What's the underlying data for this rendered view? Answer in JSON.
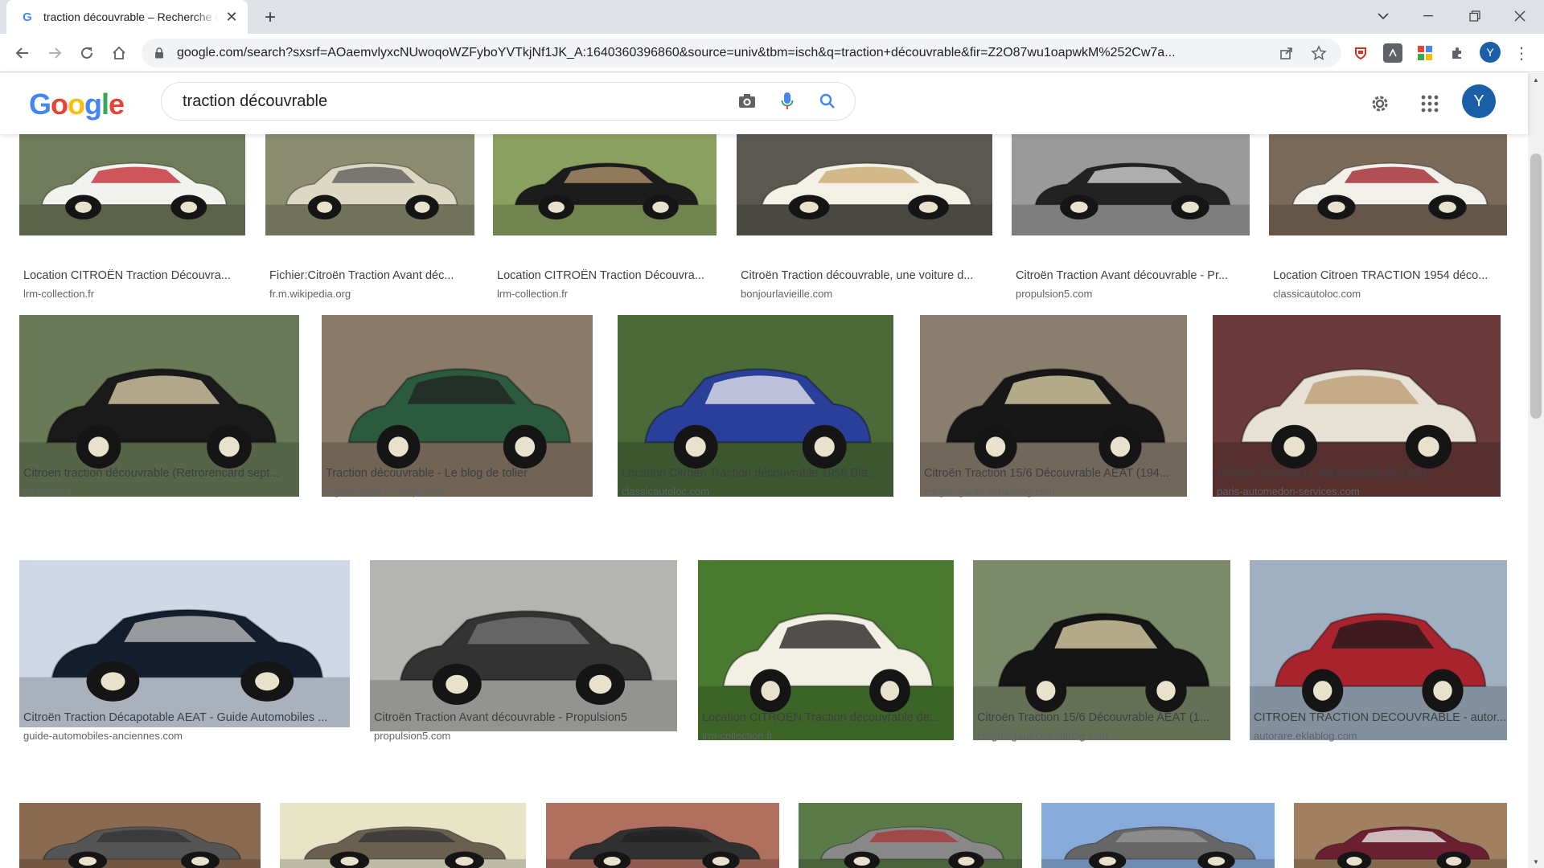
{
  "browser": {
    "tab_title": "traction découvrable – Recherche Google",
    "favicon": "G",
    "url": "google.com/search?sxsrf=AOaemvlyxcNUwoqoWZFyboYVTkjNf1JK_A:1640360396860&source=univ&tbm=isch&q=traction+découvrable&fir=Z2O87wu1oapwkM%252Cw7a...",
    "profile_initial": "Y"
  },
  "google": {
    "logo_letters": [
      "G",
      "o",
      "o",
      "g",
      "l",
      "e"
    ],
    "query": "traction découvrable",
    "avatar_initial": "Y"
  },
  "results": [
    {
      "title": "Location CITROËN Traction Découvra...",
      "domain": "lrm-collection.fr",
      "palette": {
        "bg": "#6f7b5a",
        "car": "#f2f2ee",
        "accent": "#c0202a"
      }
    },
    {
      "title": "Fichier:Citroën Traction Avant déc...",
      "domain": "fr.m.wikipedia.org",
      "palette": {
        "bg": "#8a8d70",
        "car": "#ddd8c4",
        "accent": "#555"
      }
    },
    {
      "title": "Location CITROËN Traction Découvra...",
      "domain": "lrm-collection.fr",
      "palette": {
        "bg": "#8aa060",
        "car": "#1c1c1c",
        "accent": "#b89a70"
      }
    },
    {
      "title": "Citroën Traction découvrable, une voiture d...",
      "domain": "bonjourlavieille.com",
      "palette": {
        "bg": "#5a5850",
        "car": "#f3f0e6",
        "accent": "#c8a66a"
      }
    },
    {
      "title": "Citroën Traction Avant découvrable - Pr...",
      "domain": "propulsion5.com",
      "palette": {
        "bg": "#9a9a9a",
        "car": "#222",
        "accent": "#ddd"
      }
    },
    {
      "title": "Location Citroen TRACTION 1954 déco...",
      "domain": "classicautoloc.com",
      "palette": {
        "bg": "#7a6a5a",
        "car": "#f2f0ea",
        "accent": "#9a1a22"
      }
    },
    {
      "title": "Citroen traction découvrable (Retrorencard sept...",
      "domain": "pinterest.fr",
      "palette": {
        "bg": "#6a7a58",
        "car": "#1a1a1a",
        "accent": "#e4d8b2"
      }
    },
    {
      "title": "Traction découvrable - Le blog de tolier",
      "domain": "legend-auto-concept.com",
      "palette": {
        "bg": "#8a7a68",
        "car": "#2b5a3e",
        "accent": "#222"
      }
    },
    {
      "title": "Location Citroën Traction découvrable 1956 Bla...",
      "domain": "classicautoloc.com",
      "palette": {
        "bg": "#4a6a3a",
        "car": "#2a3f9a",
        "accent": "#eeeeee"
      }
    },
    {
      "title": "Citroën Traction 15/6 Découvrable AEAT (194...",
      "domain": "zorgblogauto.canalblog.com",
      "palette": {
        "bg": "#8a7e6e",
        "car": "#171717",
        "accent": "#e8dcb0"
      }
    },
    {
      "title": "Citroën Traction 11 découvrable de 1950",
      "domain": "paris-automedon-services.com",
      "palette": {
        "bg": "#6a3a3a",
        "car": "#e6e1d4",
        "accent": "#b89a70"
      }
    },
    {
      "title": "Citroën Traction Décapotable AEAT - Guide Automobiles ...",
      "domain": "guide-automobiles-anciennes.com",
      "palette": {
        "bg": "#cfd8e6",
        "car": "#141e2e",
        "accent": "#c4c4c4"
      }
    },
    {
      "title": "Citroën Traction Avant découvrable - Propulsion5",
      "domain": "propulsion5.com",
      "palette": {
        "bg": "#b4b4b0",
        "car": "#333",
        "accent": "#777"
      }
    },
    {
      "title": "Location CITROËN Traction découvrable de...",
      "domain": "lrm-collection.fr",
      "palette": {
        "bg": "#4a7a30",
        "car": "#f2efe4",
        "accent": "#1a1a1a"
      }
    },
    {
      "title": "Citroën Traction 15/6 Découvrable AEAT (1...",
      "domain": "zorgblogauto.canalblog.com",
      "palette": {
        "bg": "#7a8a6a",
        "car": "#151515",
        "accent": "#e8dcb0"
      }
    },
    {
      "title": "CITROEN TRACTION DECOUVRABLE - autor...",
      "domain": "autorare.eklablog.com",
      "palette": {
        "bg": "#a0b0c0",
        "car": "#a8232e",
        "accent": "#1a1a1a"
      }
    },
    {
      "title": "",
      "domain": "",
      "palette": {
        "bg": "#8a6a50",
        "car": "#555",
        "accent": "#333"
      }
    },
    {
      "title": "",
      "domain": "",
      "palette": {
        "bg": "#e8e4c8",
        "car": "#6a6050",
        "accent": "#333"
      }
    },
    {
      "title": "",
      "domain": "",
      "palette": {
        "bg": "#b07060",
        "car": "#303030",
        "accent": "#222"
      }
    },
    {
      "title": "",
      "domain": "",
      "palette": {
        "bg": "#5a7a4a",
        "car": "#888",
        "accent": "#aa3333"
      }
    },
    {
      "title": "",
      "domain": "",
      "palette": {
        "bg": "#88aad8",
        "car": "#666",
        "accent": "#999"
      }
    },
    {
      "title": "",
      "domain": "",
      "palette": {
        "bg": "#a08060",
        "car": "#6a2030",
        "accent": "#eee"
      }
    }
  ]
}
